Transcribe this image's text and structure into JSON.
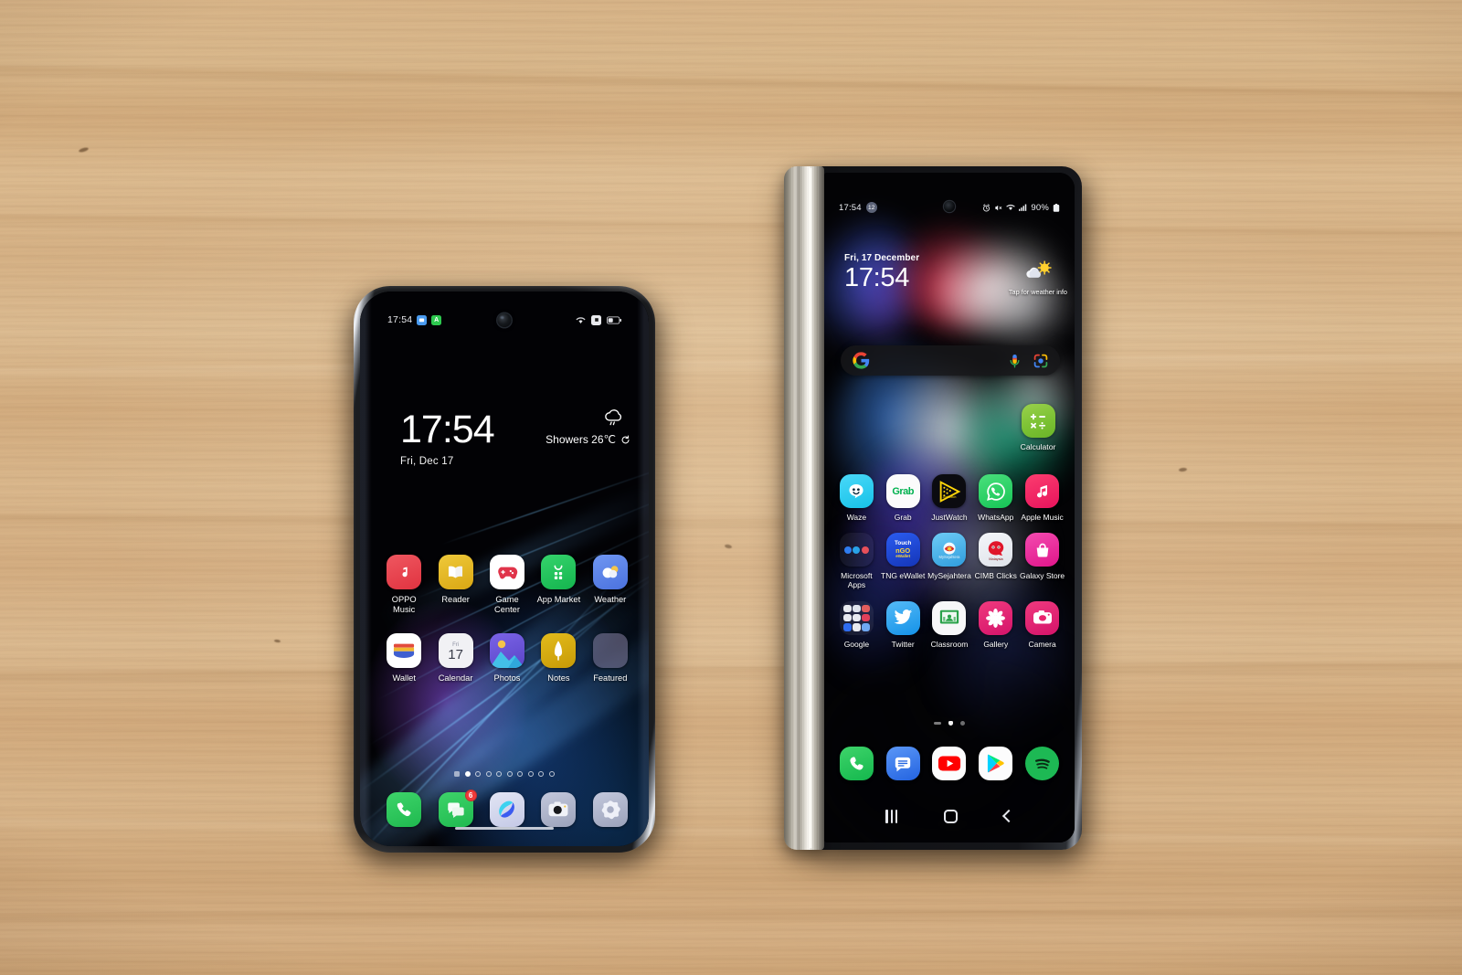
{
  "scene": {
    "description": "Two smartphones on a light beech wooden table",
    "background_color": "#d6b286"
  },
  "oppo": {
    "device_name": "OPPO phone",
    "status_bar": {
      "time": "17:54",
      "left_icons": [
        "messages-badge-icon",
        "app-badge-icon"
      ],
      "right_icons": [
        "wifi-icon",
        "sim-icon",
        "battery-icon"
      ]
    },
    "lockscreen": {
      "time": "17:54",
      "date": "Fri, Dec 17",
      "weather_text": "Showers 26℃",
      "weather_icon": "rain-cloud-icon",
      "refresh_icon": "refresh-icon"
    },
    "apps": [
      {
        "label": "OPPO Music",
        "icon": "oppo-music-icon",
        "color": "#e8424a"
      },
      {
        "label": "Reader",
        "icon": "reader-icon",
        "color": "#e2b92a"
      },
      {
        "label": "Game Center",
        "icon": "game-center-icon",
        "color": "#ffffff"
      },
      {
        "label": "App Market",
        "icon": "app-market-icon",
        "color": "#23c55e"
      },
      {
        "label": "Weather",
        "icon": "weather-icon",
        "color": "#5b86e8"
      },
      {
        "label": "Wallet",
        "icon": "wallet-icon",
        "color": "#ffffff"
      },
      {
        "label": "Calendar",
        "icon": "calendar-icon",
        "color": "#f0f0f2"
      },
      {
        "label": "Photos",
        "icon": "photos-icon",
        "color": "#6b57d8"
      },
      {
        "label": "Notes",
        "icon": "notes-icon",
        "color": "#d8ac14"
      },
      {
        "label": "Featured",
        "icon": "featured-folder-icon",
        "color": "#6a6380"
      }
    ],
    "calendar_day": "17",
    "calendar_weekday": "Fri",
    "pages": {
      "total_dots": 10,
      "active_index": 1,
      "has_leading_square": true
    },
    "dock": [
      {
        "label": "Phone",
        "icon": "phone-icon",
        "color": "#2ec457",
        "badge": ""
      },
      {
        "label": "Messages",
        "icon": "messages-icon",
        "color": "#2ec457",
        "badge": "6"
      },
      {
        "label": "Browser",
        "icon": "browser-icon",
        "color": "#c9cde6",
        "badge": ""
      },
      {
        "label": "Camera",
        "icon": "camera-icon",
        "color": "#a7adc4",
        "badge": ""
      },
      {
        "label": "Settings",
        "icon": "settings-icon",
        "color": "#a7adc4",
        "badge": ""
      }
    ]
  },
  "samsung": {
    "device_name": "Samsung Galaxy Z Fold (cover screen)",
    "status_bar": {
      "time": "17:54",
      "left_icons": [
        "notification-count-icon"
      ],
      "notification_count": "12",
      "right_icons": [
        "alarm-icon",
        "mute-icon",
        "wifi-icon",
        "signal-icon"
      ],
      "battery_percent": "90%",
      "battery_icon": "battery-icon"
    },
    "clock_widget": {
      "date": "Fri, 17 December",
      "time": "17:54",
      "weather_icon": "sun-cloud-icon",
      "weather_tip": "Tap for weather info"
    },
    "search_bar": {
      "logo": "google-g-icon",
      "mic_icon": "microphone-icon",
      "lens_icon": "google-lens-icon"
    },
    "calculator_widget": {
      "label": "Calculator",
      "icon": "calculator-icon",
      "color": "#7cc234"
    },
    "apps": [
      {
        "label": "Waze",
        "icon": "waze-icon",
        "color": "#33ccff"
      },
      {
        "label": "Grab",
        "icon": "grab-icon",
        "color": "#ffffff"
      },
      {
        "label": "JustWatch",
        "icon": "justwatch-icon",
        "color": "#0c0c10"
      },
      {
        "label": "WhatsApp",
        "icon": "whatsapp-icon",
        "color": "#25d366"
      },
      {
        "label": "Apple Music",
        "icon": "apple-music-icon",
        "color": "#f4246b"
      },
      {
        "label": "Microsoft Apps",
        "icon": "microsoft-folder-icon",
        "color": "#1b1b1f"
      },
      {
        "label": "TNG eWallet",
        "icon": "tng-ewallet-icon",
        "color": "#1b45c8"
      },
      {
        "label": "MySejahtera",
        "icon": "mysejahtera-icon",
        "color": "#49b3ef"
      },
      {
        "label": "CIMB Clicks",
        "icon": "cimb-clicks-icon",
        "color": "#e0152a"
      },
      {
        "label": "Galaxy Store",
        "icon": "galaxy-store-icon",
        "color": "#ef2f8e"
      },
      {
        "label": "Google",
        "icon": "google-folder-icon",
        "color": "#1b1b1f"
      },
      {
        "label": "Twitter",
        "icon": "twitter-icon",
        "color": "#1da1f2"
      },
      {
        "label": "Classroom",
        "icon": "classroom-icon",
        "color": "#ffffff"
      },
      {
        "label": "Gallery",
        "icon": "gallery-icon",
        "color": "#e9246e"
      },
      {
        "label": "Camera",
        "icon": "camera-icon",
        "color": "#e9246e"
      }
    ],
    "pages": {
      "items": [
        "apps-list-indicator",
        "home-indicator",
        "page-dot"
      ],
      "active_index": 1
    },
    "dock": [
      {
        "label": "Phone",
        "icon": "phone-icon",
        "color": "#2ec457"
      },
      {
        "label": "Messages",
        "icon": "messages-icon",
        "color": "#2f7df0"
      },
      {
        "label": "YouTube",
        "icon": "youtube-icon",
        "color": "#ffffff"
      },
      {
        "label": "Play Store",
        "icon": "play-store-icon",
        "color": "#ffffff"
      },
      {
        "label": "Spotify",
        "icon": "spotify-icon",
        "color": "#1db954"
      }
    ],
    "nav_bar": [
      {
        "label": "Recents",
        "icon": "recents-icon"
      },
      {
        "label": "Home",
        "icon": "home-icon"
      },
      {
        "label": "Back",
        "icon": "back-icon"
      }
    ]
  }
}
